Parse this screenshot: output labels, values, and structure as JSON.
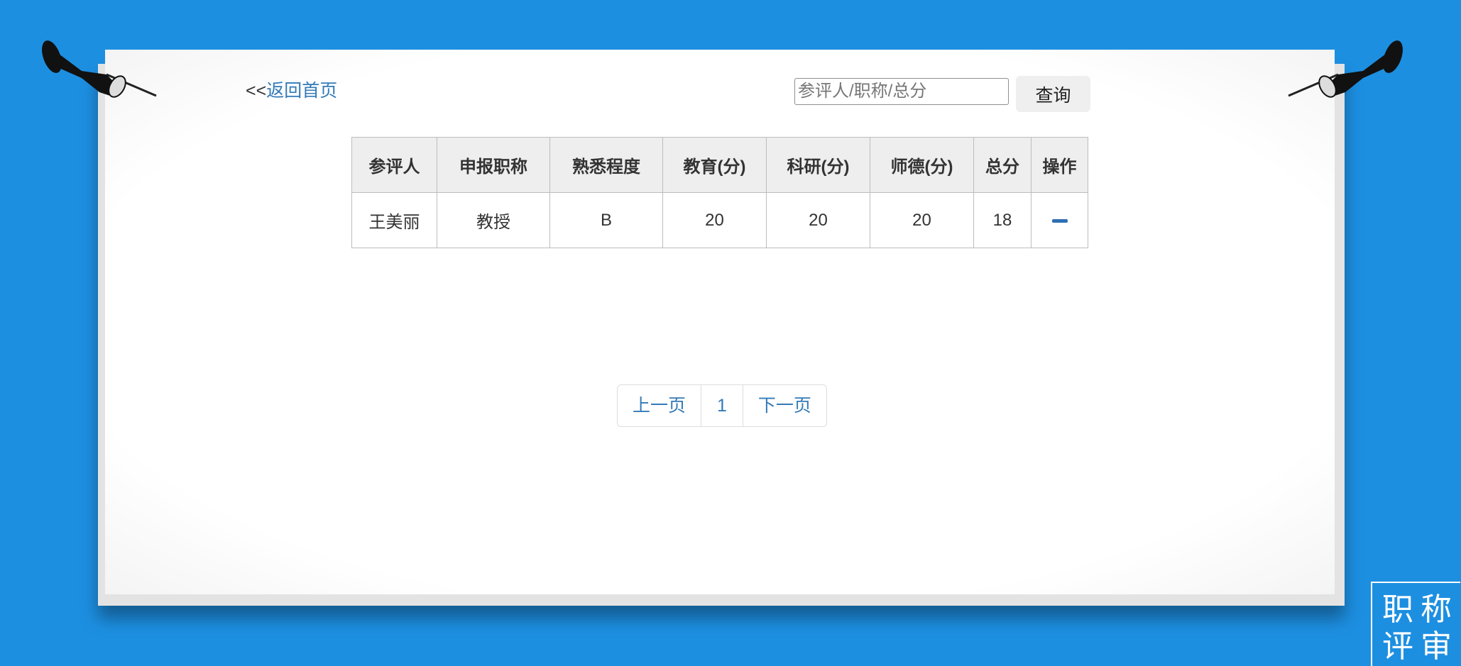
{
  "header": {
    "back_prefix": "<<",
    "back_link": "返回首页"
  },
  "search": {
    "placeholder": "参评人/职称/总分",
    "value": "",
    "button_label": "查询"
  },
  "table": {
    "columns": [
      "参评人",
      "申报职称",
      "熟悉程度",
      "教育(分)",
      "科研(分)",
      "师德(分)",
      "总分",
      "操作"
    ],
    "rows": [
      {
        "name": "王美丽",
        "title": "教授",
        "familiarity": "B",
        "education": "20",
        "research": "20",
        "ethics": "20",
        "total": "18",
        "action_icon": "edit-icon"
      }
    ]
  },
  "pagination": {
    "prev": "上一页",
    "current": "1",
    "next": "下一页"
  },
  "logo": {
    "line1": "职称",
    "line2": "评审"
  },
  "colors": {
    "background": "#1d8fe1",
    "link": "#337ab7",
    "header_bg": "#eeeeee"
  }
}
